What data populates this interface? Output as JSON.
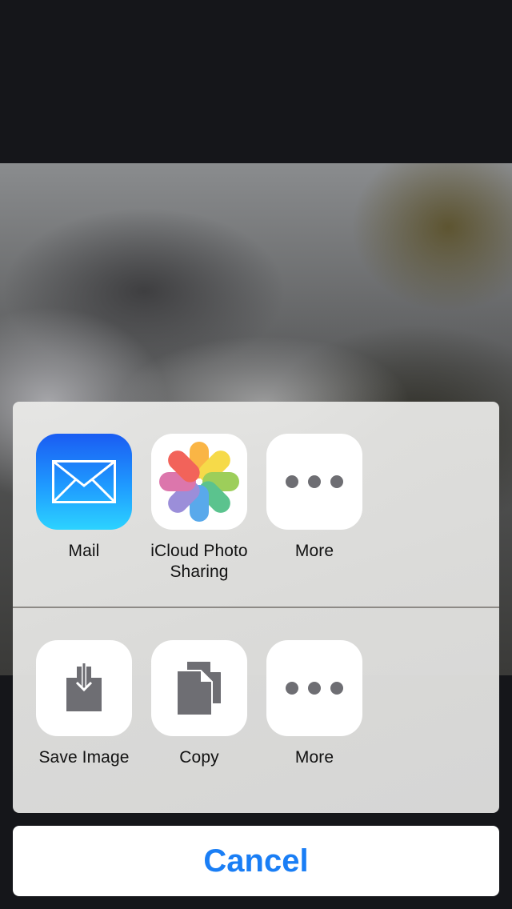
{
  "share_row": [
    {
      "label": "Mail",
      "icon": "mail-icon"
    },
    {
      "label": "iCloud Photo Sharing",
      "icon": "photos-icon"
    },
    {
      "label": "More",
      "icon": "more-dots-icon"
    }
  ],
  "action_row": [
    {
      "label": "Save Image",
      "icon": "save-image-icon"
    },
    {
      "label": "Copy",
      "icon": "copy-icon"
    },
    {
      "label": "More",
      "icon": "more-dots-icon"
    }
  ],
  "cancel_label": "Cancel",
  "colors": {
    "accent": "#1a7ef5",
    "glyph": "#6e6e73",
    "mail_top": "#1a5cf2",
    "mail_bottom": "#2cd3ff"
  }
}
